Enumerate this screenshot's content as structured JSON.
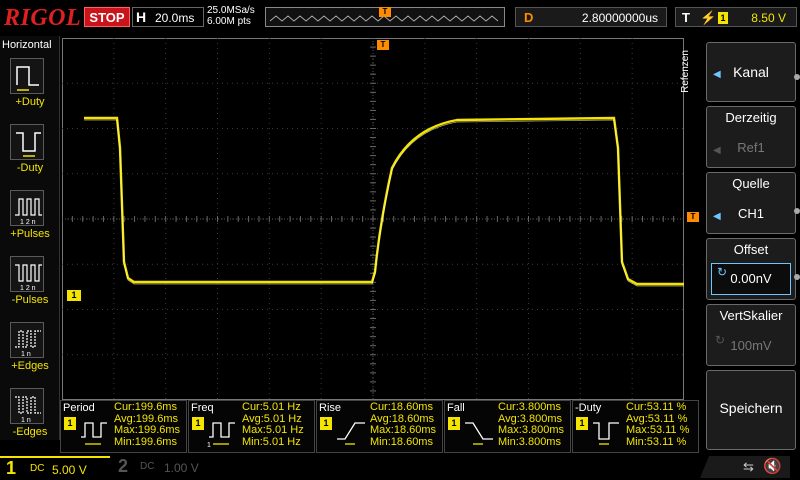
{
  "topbar": {
    "logo": "RIGOL",
    "run_state": "STOP",
    "h_letter": "H",
    "timebase": "20.0ms",
    "sample_rate": "25.0MSa/s",
    "mem_depth": "6.00M pts",
    "trig_pos_marker": "T",
    "delay_letter": "D",
    "delay_value": "2.80000000us",
    "trig_letter": "T",
    "trig_edge": "rising-edge-icon",
    "trig_source": "1",
    "trig_level": "8.50 V"
  },
  "left_panel": {
    "title": "Horizontal",
    "items": [
      {
        "label": "+Duty",
        "icon": "positive-duty-icon"
      },
      {
        "label": "-Duty",
        "icon": "negative-duty-icon"
      },
      {
        "label": "+Pulses",
        "icon": "positive-pulses-icon"
      },
      {
        "label": "-Pulses",
        "icon": "negative-pulses-icon"
      },
      {
        "label": "+Edges",
        "icon": "positive-edges-icon"
      },
      {
        "label": "-Edges",
        "icon": "negative-edges-icon"
      }
    ]
  },
  "markers": {
    "ch1": "1",
    "trig_level": "T",
    "trig_time": "T"
  },
  "measurements": [
    {
      "name": "Period",
      "ch": "1",
      "cur": "Cur:199.6ms",
      "avg": "Avg:199.6ms",
      "max": "Max:199.6ms",
      "min": "Min:199.6ms"
    },
    {
      "name": "Freq",
      "ch": "1",
      "cur": "Cur:5.01 Hz",
      "avg": "Avg:5.01 Hz",
      "max": "Max:5.01 Hz",
      "min": "Min:5.01 Hz"
    },
    {
      "name": "Rise",
      "ch": "1",
      "cur": "Cur:18.60ms",
      "avg": "Avg:18.60ms",
      "max": "Max:18.60ms",
      "min": "Min:18.60ms"
    },
    {
      "name": "Fall",
      "ch": "1",
      "cur": "Cur:3.800ms",
      "avg": "Avg:3.800ms",
      "max": "Max:3.800ms",
      "min": "Min:3.800ms"
    },
    {
      "name": "-Duty",
      "ch": "1",
      "cur": "Cur:53.11 %",
      "avg": "Avg:53.11 %",
      "max": "Max:53.11 %",
      "min": "Min:53.11 %"
    }
  ],
  "right_menu": {
    "section_title": "Refenzen",
    "items": [
      {
        "title": "",
        "value": "Kanal",
        "enabled": true
      },
      {
        "title": "Derzeitig",
        "value": "Ref1",
        "enabled": false
      },
      {
        "title": "Quelle",
        "value": "CH1",
        "enabled": true
      },
      {
        "title": "Offset",
        "value": "0.00nV",
        "enabled": true
      },
      {
        "title": "VertSkalier",
        "value": "100mV",
        "enabled": false
      },
      {
        "title": "",
        "value": "Speichern",
        "enabled": true
      }
    ]
  },
  "bottombar": {
    "ch1_num": "1",
    "ch1_coupling": "DC",
    "ch1_scale": "5.00 V",
    "ch2_num": "2",
    "ch2_coupling": "DC",
    "ch2_scale": "1.00 V"
  },
  "colors": {
    "ch1": "#f4e400",
    "trigger": "#ff8c00",
    "grid": "#3a3a3a",
    "accent_blue": "#6fc6ff",
    "stop": "#c8141a"
  }
}
